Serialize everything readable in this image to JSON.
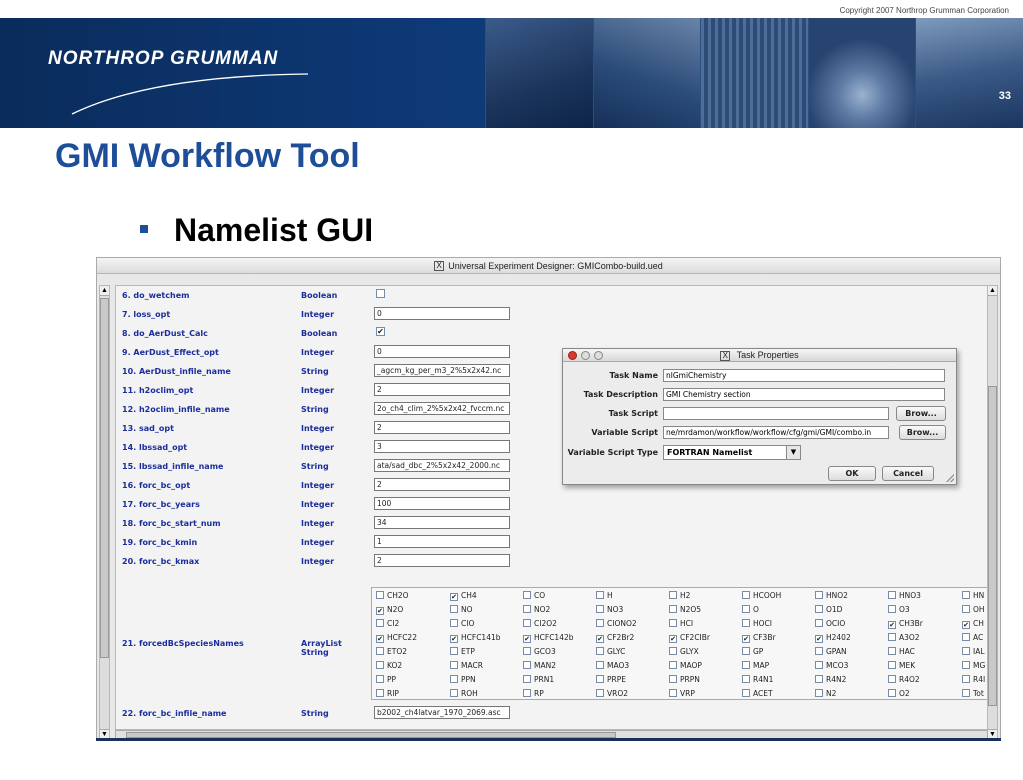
{
  "slide": {
    "copyright": "Copyright 2007 Northrop Grumman Corporation",
    "logo": "NORTHROP GRUMMAN",
    "page_number": "33",
    "title": "GMI Workflow Tool",
    "bullet": "Namelist GUI"
  },
  "app": {
    "window_title": "Universal Experiment Designer: GMICombo-build.ued",
    "rows": [
      {
        "name": "6. do_wetchem",
        "type": "Boolean",
        "checked": false
      },
      {
        "name": "7. loss_opt",
        "type": "Integer",
        "value": "0"
      },
      {
        "name": "8. do_AerDust_Calc",
        "type": "Boolean",
        "checked": true
      },
      {
        "name": "9. AerDust_Effect_opt",
        "type": "Integer",
        "value": "0"
      },
      {
        "name": "10. AerDust_infile_name",
        "type": "String",
        "value": "_agcm_kg_per_m3_2%5x2x42.nc"
      },
      {
        "name": "11. h2oclim_opt",
        "type": "Integer",
        "value": "2"
      },
      {
        "name": "12. h2oclim_infile_name",
        "type": "String",
        "value": "2o_ch4_clim_2%5x2x42_fvccm.nc"
      },
      {
        "name": "13. sad_opt",
        "type": "Integer",
        "value": "2"
      },
      {
        "name": "14. lbssad_opt",
        "type": "Integer",
        "value": "3"
      },
      {
        "name": "15. lbssad_infile_name",
        "type": "String",
        "value": "ata/sad_dbc_2%5x2x42_2000.nc"
      },
      {
        "name": "16. forc_bc_opt",
        "type": "Integer",
        "value": "2"
      },
      {
        "name": "17. forc_bc_years",
        "type": "Integer",
        "value": "100"
      },
      {
        "name": "18. forc_bc_start_num",
        "type": "Integer",
        "value": "34"
      },
      {
        "name": "19. forc_bc_kmin",
        "type": "Integer",
        "value": "1"
      },
      {
        "name": "20. forc_bc_kmax",
        "type": "Integer",
        "value": "2"
      }
    ],
    "species_row": {
      "name": "21. forcedBcSpeciesNames",
      "type": "ArrayList String"
    },
    "species": [
      [
        {
          "l": "CH2O",
          "c": false
        },
        {
          "l": "CH4",
          "c": true
        },
        {
          "l": "CO",
          "c": false
        },
        {
          "l": "H",
          "c": false
        },
        {
          "l": "H2",
          "c": false
        },
        {
          "l": "HCOOH",
          "c": false
        },
        {
          "l": "HNO2",
          "c": false
        },
        {
          "l": "HNO3",
          "c": false
        },
        {
          "l": "HN",
          "c": false
        }
      ],
      [
        {
          "l": "N2O",
          "c": true
        },
        {
          "l": "NO",
          "c": false
        },
        {
          "l": "NO2",
          "c": false
        },
        {
          "l": "NO3",
          "c": false
        },
        {
          "l": "N2O5",
          "c": false
        },
        {
          "l": "O",
          "c": false
        },
        {
          "l": "O1D",
          "c": false
        },
        {
          "l": "O3",
          "c": false
        },
        {
          "l": "OH",
          "c": false
        }
      ],
      [
        {
          "l": "CI2",
          "c": false
        },
        {
          "l": "CIO",
          "c": false
        },
        {
          "l": "CI2O2",
          "c": false
        },
        {
          "l": "CIONO2",
          "c": false
        },
        {
          "l": "HCI",
          "c": false
        },
        {
          "l": "HOCI",
          "c": false
        },
        {
          "l": "OCIO",
          "c": false
        },
        {
          "l": "CH3Br",
          "c": true
        },
        {
          "l": "CH",
          "c": true
        }
      ],
      [
        {
          "l": "HCFC22",
          "c": true
        },
        {
          "l": "HCFC141b",
          "c": true
        },
        {
          "l": "HCFC142b",
          "c": true
        },
        {
          "l": "CF2Br2",
          "c": true
        },
        {
          "l": "CF2CIBr",
          "c": true
        },
        {
          "l": "CF3Br",
          "c": true
        },
        {
          "l": "H2402",
          "c": true
        },
        {
          "l": "A3O2",
          "c": false
        },
        {
          "l": "AC",
          "c": false
        }
      ],
      [
        {
          "l": "ETO2",
          "c": false
        },
        {
          "l": "ETP",
          "c": false
        },
        {
          "l": "GCO3",
          "c": false
        },
        {
          "l": "GLYC",
          "c": false
        },
        {
          "l": "GLYX",
          "c": false
        },
        {
          "l": "GP",
          "c": false
        },
        {
          "l": "GPAN",
          "c": false
        },
        {
          "l": "HAC",
          "c": false
        },
        {
          "l": "IAL",
          "c": false
        }
      ],
      [
        {
          "l": "KO2",
          "c": false
        },
        {
          "l": "MACR",
          "c": false
        },
        {
          "l": "MAN2",
          "c": false
        },
        {
          "l": "MAO3",
          "c": false
        },
        {
          "l": "MAOP",
          "c": false
        },
        {
          "l": "MAP",
          "c": false
        },
        {
          "l": "MCO3",
          "c": false
        },
        {
          "l": "MEK",
          "c": false
        },
        {
          "l": "MG",
          "c": false
        }
      ],
      [
        {
          "l": "PP",
          "c": false
        },
        {
          "l": "PPN",
          "c": false
        },
        {
          "l": "PRN1",
          "c": false
        },
        {
          "l": "PRPE",
          "c": false
        },
        {
          "l": "PRPN",
          "c": false
        },
        {
          "l": "R4N1",
          "c": false
        },
        {
          "l": "R4N2",
          "c": false
        },
        {
          "l": "R4O2",
          "c": false
        },
        {
          "l": "R4I",
          "c": false
        }
      ],
      [
        {
          "l": "RIP",
          "c": false
        },
        {
          "l": "ROH",
          "c": false
        },
        {
          "l": "RP",
          "c": false
        },
        {
          "l": "VRO2",
          "c": false
        },
        {
          "l": "VRP",
          "c": false
        },
        {
          "l": "ACET",
          "c": false
        },
        {
          "l": "N2",
          "c": false
        },
        {
          "l": "O2",
          "c": false
        },
        {
          "l": "Tot",
          "c": false
        }
      ]
    ],
    "last_row": {
      "name": "22. forc_bc_infile_name",
      "type": "String",
      "value": "b2002_ch4latvar_1970_2069.asc"
    }
  },
  "dialog": {
    "title": "Task Properties",
    "task_name_label": "Task Name",
    "task_name": "nlGmiChemistry",
    "task_desc_label": "Task Description",
    "task_desc": "GMI Chemistry section",
    "task_script_label": "Task Script",
    "task_script": "",
    "variable_script_label": "Variable Script",
    "variable_script": "ne/mrdamon/workflow/workflow/cfg/gmi/GMI/combo.in",
    "variable_script_type_label": "Variable Script Type",
    "variable_script_type": "FORTRAN Namelist",
    "browse_label": "Brow...",
    "ok_label": "OK",
    "cancel_label": "Cancel"
  }
}
